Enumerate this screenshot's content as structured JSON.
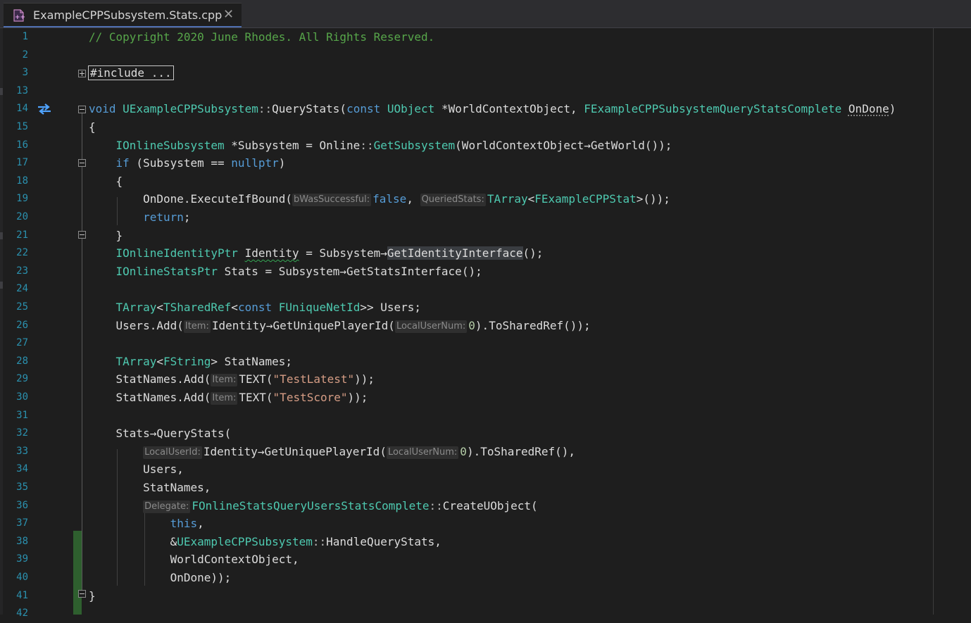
{
  "tab": {
    "title": "ExampleCPPSubsystem.Stats.cpp",
    "close_glyph": "✕",
    "icon": "cpp-file-icon"
  },
  "colors": {
    "background": "#1e1e1e",
    "keyword": "#569cd6",
    "type": "#4ec9b0",
    "comment": "#57a64a",
    "string": "#d69d85",
    "line_number": "#2b91af"
  },
  "editor": {
    "lines": [
      {
        "num": "1"
      },
      {
        "num": "2"
      },
      {
        "num": "3"
      },
      {
        "num": "13"
      },
      {
        "num": "14"
      },
      {
        "num": "15"
      },
      {
        "num": "16"
      },
      {
        "num": "17"
      },
      {
        "num": "18"
      },
      {
        "num": "19"
      },
      {
        "num": "20"
      },
      {
        "num": "21"
      },
      {
        "num": "22"
      },
      {
        "num": "23"
      },
      {
        "num": "24"
      },
      {
        "num": "25"
      },
      {
        "num": "26"
      },
      {
        "num": "27"
      },
      {
        "num": "28"
      },
      {
        "num": "29"
      },
      {
        "num": "30"
      },
      {
        "num": "31"
      },
      {
        "num": "32"
      },
      {
        "num": "33"
      },
      {
        "num": "34"
      },
      {
        "num": "35"
      },
      {
        "num": "36"
      },
      {
        "num": "37"
      },
      {
        "num": "38"
      },
      {
        "num": "39"
      },
      {
        "num": "40"
      },
      {
        "num": "41"
      },
      {
        "num": "42"
      }
    ],
    "code": {
      "l1": "// Copyright 2020 June Rhodes. All Rights Reserved.",
      "l3": "#include ...",
      "l14": [
        {
          "t": "void",
          "c": "k"
        },
        {
          "t": " "
        },
        {
          "t": "UExampleCPPSubsystem",
          "c": "t"
        },
        {
          "t": "::",
          "c": "op"
        },
        {
          "t": "QueryStats("
        },
        {
          "t": "const",
          "c": "k"
        },
        {
          "t": " "
        },
        {
          "t": "UObject",
          "c": "t"
        },
        {
          "t": " *WorldContextObject, "
        },
        {
          "t": "FExampleCPPSubsystemQueryStatsComplete",
          "c": "t"
        },
        {
          "t": " "
        },
        {
          "t": "OnDone",
          "c": "ulink"
        },
        {
          "t": ")"
        }
      ],
      "l15": [
        {
          "t": "{"
        }
      ],
      "l16": [
        {
          "t": "    "
        },
        {
          "t": "IOnlineSubsystem",
          "c": "t"
        },
        {
          "t": " *Subsystem = Online"
        },
        {
          "t": "::",
          "c": "op"
        },
        {
          "t": "GetSubsystem",
          "c": "t"
        },
        {
          "t": "(WorldContextObject→GetWorld());"
        }
      ],
      "l17": [
        {
          "t": "    "
        },
        {
          "t": "if",
          "c": "k"
        },
        {
          "t": " (Subsystem == "
        },
        {
          "t": "nullptr",
          "c": "k"
        },
        {
          "t": ")"
        }
      ],
      "l18": [
        {
          "t": "    {"
        }
      ],
      "l19": [
        {
          "t": "        OnDone.ExecuteIfBound("
        },
        {
          "t": "bWasSuccessful:",
          "c": "hint"
        },
        {
          "t": "false",
          "c": "k"
        },
        {
          "t": ", "
        },
        {
          "t": "QueriedStats:",
          "c": "hint"
        },
        {
          "t": "TArray",
          "c": "t"
        },
        {
          "t": "<"
        },
        {
          "t": "FExampleCPPStat",
          "c": "t"
        },
        {
          "t": ">());"
        }
      ],
      "l20": [
        {
          "t": "        "
        },
        {
          "t": "return",
          "c": "k"
        },
        {
          "t": ";"
        }
      ],
      "l21": [
        {
          "t": "    }"
        }
      ],
      "l22": [
        {
          "t": "    "
        },
        {
          "t": "IOnlineIdentityPtr",
          "c": "t"
        },
        {
          "t": " "
        },
        {
          "t": "Identity",
          "c": "squiggle"
        },
        {
          "t": " = Subsystem→"
        },
        {
          "t": "GetIdentityInterface",
          "c": "hl"
        },
        {
          "t": "();"
        }
      ],
      "l23": [
        {
          "t": "    "
        },
        {
          "t": "IOnlineStatsPtr",
          "c": "t"
        },
        {
          "t": " Stats = Subsystem→GetStatsInterface();"
        }
      ],
      "l24": [
        {
          "t": ""
        }
      ],
      "l25": [
        {
          "t": "    "
        },
        {
          "t": "TArray",
          "c": "t"
        },
        {
          "t": "<"
        },
        {
          "t": "TSharedRef",
          "c": "t"
        },
        {
          "t": "<"
        },
        {
          "t": "const",
          "c": "k"
        },
        {
          "t": " "
        },
        {
          "t": "FUniqueNetId",
          "c": "t"
        },
        {
          "t": ">> Users;"
        }
      ],
      "l26": [
        {
          "t": "    Users.Add("
        },
        {
          "t": "Item:",
          "c": "hint"
        },
        {
          "t": "Identity→GetUniquePlayerId("
        },
        {
          "t": "LocalUserNum:",
          "c": "hint"
        },
        {
          "t": "0",
          "c": "n"
        },
        {
          "t": ").ToSharedRef());"
        }
      ],
      "l27": [
        {
          "t": ""
        }
      ],
      "l28": [
        {
          "t": "    "
        },
        {
          "t": "TArray",
          "c": "t"
        },
        {
          "t": "<"
        },
        {
          "t": "FString",
          "c": "t"
        },
        {
          "t": "> StatNames;"
        }
      ],
      "l29": [
        {
          "t": "    StatNames.Add("
        },
        {
          "t": "Item:",
          "c": "hint"
        },
        {
          "t": "TEXT("
        },
        {
          "t": "\"TestLatest\"",
          "c": "s"
        },
        {
          "t": "));"
        }
      ],
      "l30": [
        {
          "t": "    StatNames.Add("
        },
        {
          "t": "Item:",
          "c": "hint"
        },
        {
          "t": "TEXT("
        },
        {
          "t": "\"TestScore\"",
          "c": "s"
        },
        {
          "t": "));"
        }
      ],
      "l31": [
        {
          "t": ""
        }
      ],
      "l32": [
        {
          "t": "    Stats→QueryStats("
        }
      ],
      "l33": [
        {
          "t": "        "
        },
        {
          "t": "LocalUserId:",
          "c": "hint"
        },
        {
          "t": "Identity→GetUniquePlayerId("
        },
        {
          "t": "LocalUserNum:",
          "c": "hint"
        },
        {
          "t": "0",
          "c": "n"
        },
        {
          "t": ").ToSharedRef(),"
        }
      ],
      "l34": [
        {
          "t": "        Users,"
        }
      ],
      "l35": [
        {
          "t": "        StatNames,"
        }
      ],
      "l36": [
        {
          "t": "        "
        },
        {
          "t": "Delegate:",
          "c": "hint"
        },
        {
          "t": "FOnlineStatsQueryUsersStatsComplete",
          "c": "t"
        },
        {
          "t": "::",
          "c": "op"
        },
        {
          "t": "CreateUObject("
        }
      ],
      "l37": [
        {
          "t": "            "
        },
        {
          "t": "this",
          "c": "k"
        },
        {
          "t": ","
        }
      ],
      "l38": [
        {
          "t": "            &"
        },
        {
          "t": "UExampleCPPSubsystem",
          "c": "t"
        },
        {
          "t": "::",
          "c": "op"
        },
        {
          "t": "HandleQueryStats,"
        }
      ],
      "l39": [
        {
          "t": "            WorldContextObject,"
        }
      ],
      "l40": [
        {
          "t": "            OnDone));"
        }
      ],
      "l41": [
        {
          "t": "}"
        }
      ],
      "l42": [
        {
          "t": ""
        }
      ]
    }
  }
}
